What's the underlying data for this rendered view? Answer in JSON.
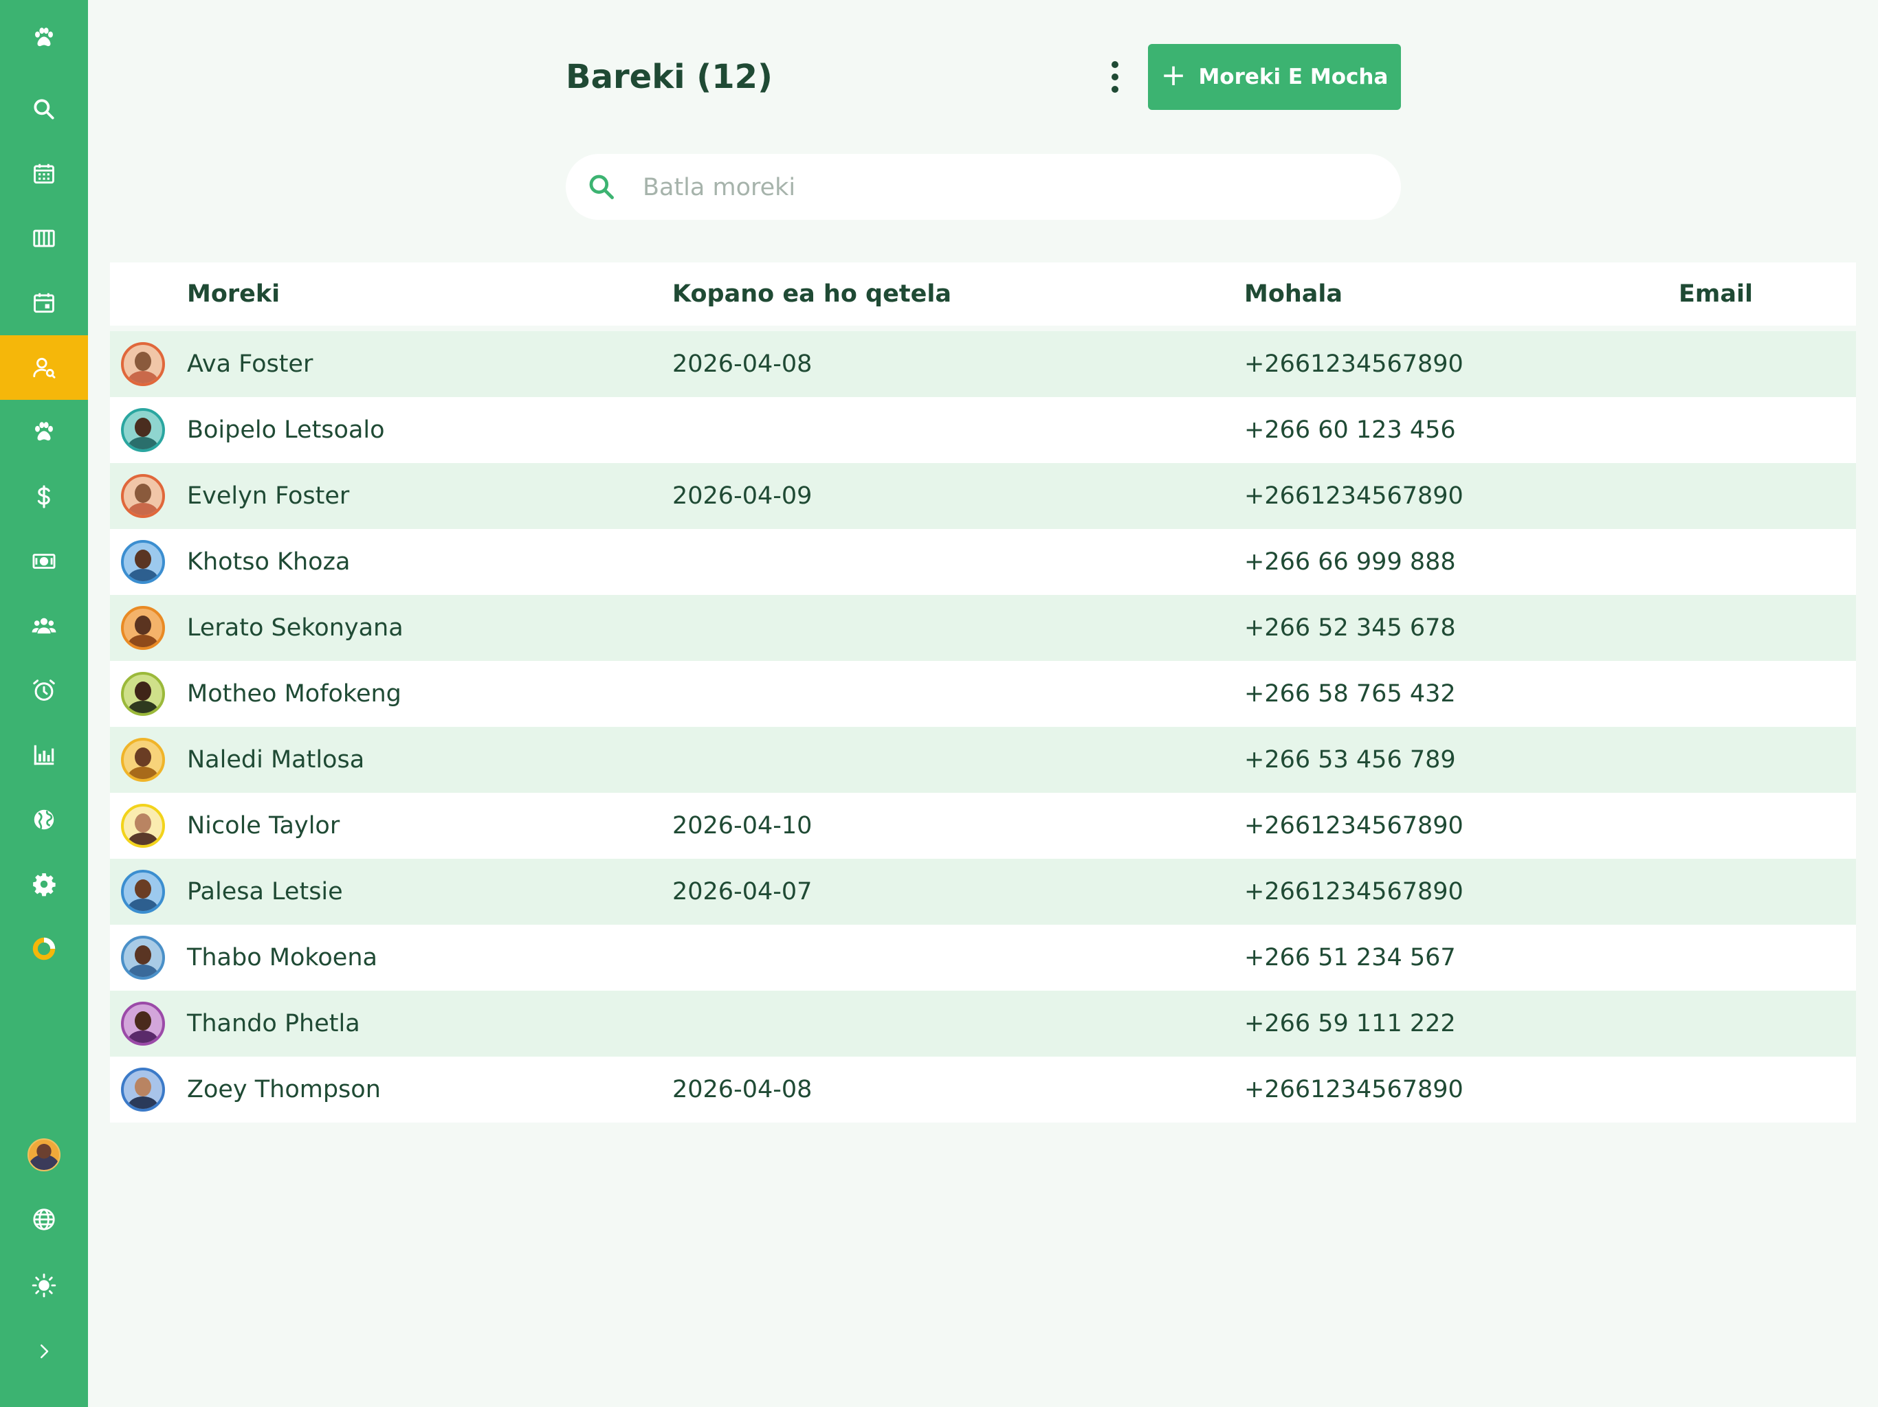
{
  "colors": {
    "brand_green": "#3cb371",
    "active_yellow": "#f5b70a",
    "text_dark": "#1f4a34",
    "row_alt": "#e6f5ea"
  },
  "sidebar": {
    "top_items": [
      {
        "icon": "paw-icon"
      },
      {
        "icon": "search-icon"
      },
      {
        "icon": "calendar-grid-icon"
      },
      {
        "icon": "columns-icon"
      },
      {
        "icon": "calendar-day-icon"
      },
      {
        "icon": "user-search-icon",
        "active": true
      },
      {
        "icon": "paw-icon"
      },
      {
        "icon": "dollar-icon"
      },
      {
        "icon": "cash-icon"
      },
      {
        "icon": "users-icon"
      },
      {
        "icon": "alarm-clock-icon"
      },
      {
        "icon": "bar-chart-icon"
      },
      {
        "icon": "globe-icon"
      },
      {
        "icon": "gear-icon"
      },
      {
        "icon": "donut-chart-icon"
      }
    ],
    "bottom_items": [
      {
        "icon": "user-avatar"
      },
      {
        "icon": "language-globe-icon"
      },
      {
        "icon": "sun-icon"
      },
      {
        "icon": "chevron-right-icon"
      }
    ]
  },
  "header": {
    "title": "Bareki (12)",
    "add_button_label": "Moreki E Mocha"
  },
  "search": {
    "placeholder": "Batla moreki",
    "value": ""
  },
  "table": {
    "columns": [
      "Moreki",
      "Kopano ea ho qetela",
      "Mohala",
      "Email"
    ],
    "rows": [
      {
        "name": "Ava Foster",
        "last_meeting": "2026-04-08",
        "phone": "+2661234567890",
        "email": "",
        "ring": "#e0673b",
        "skin": "#8a5a3c",
        "shirt": "#c9694a",
        "bg": "#f1c6a8"
      },
      {
        "name": "Boipelo Letsoalo",
        "last_meeting": "",
        "phone": "+266 60 123 456",
        "email": "",
        "ring": "#2aa6a0",
        "skin": "#4a2d1f",
        "shirt": "#2a6f6c",
        "bg": "#8fd5cf"
      },
      {
        "name": "Evelyn Foster",
        "last_meeting": "2026-04-09",
        "phone": "+2661234567890",
        "email": "",
        "ring": "#e0673b",
        "skin": "#8a5a3c",
        "shirt": "#c9694a",
        "bg": "#f1c6a8"
      },
      {
        "name": "Khotso Khoza",
        "last_meeting": "",
        "phone": "+266 66 999 888",
        "email": "",
        "ring": "#3b8ed0",
        "skin": "#5a3523",
        "shirt": "#2d5f8f",
        "bg": "#9cc9ee"
      },
      {
        "name": "Lerato Sekonyana",
        "last_meeting": "",
        "phone": "+266 52 345 678",
        "email": "",
        "ring": "#e98a24",
        "skin": "#5b3420",
        "shirt": "#8f4a1a",
        "bg": "#f4b36a"
      },
      {
        "name": "Motheo Mofokeng",
        "last_meeting": "",
        "phone": "+266 58 765 432",
        "email": "",
        "ring": "#9bb93a",
        "skin": "#3f2518",
        "shirt": "#2f3a1f",
        "bg": "#cfe08a"
      },
      {
        "name": "Naledi Matlosa",
        "last_meeting": "",
        "phone": "+266 53 456 789",
        "email": "",
        "ring": "#f0b429",
        "skin": "#6a3d24",
        "shirt": "#a86a1a",
        "bg": "#f7d37a"
      },
      {
        "name": "Nicole Taylor",
        "last_meeting": "2026-04-10",
        "phone": "+2661234567890",
        "email": "",
        "ring": "#f2d31b",
        "skin": "#b98462",
        "shirt": "#5a3a2a",
        "bg": "#faecb0"
      },
      {
        "name": "Palesa Letsie",
        "last_meeting": "2026-04-07",
        "phone": "+2661234567890",
        "email": "",
        "ring": "#3b8ed0",
        "skin": "#6a3d24",
        "shirt": "#2d5f8f",
        "bg": "#9cc9ee"
      },
      {
        "name": "Thabo Mokoena",
        "last_meeting": "",
        "phone": "+266 51 234 567",
        "email": "",
        "ring": "#4a90c8",
        "skin": "#5a3523",
        "shirt": "#3a6a9a",
        "bg": "#a8cbe6"
      },
      {
        "name": "Thando Phetla",
        "last_meeting": "",
        "phone": "+266 59 111 222",
        "email": "",
        "ring": "#9b4aa8",
        "skin": "#4a2a1c",
        "shirt": "#5a2a6a",
        "bg": "#d3a6db"
      },
      {
        "name": "Zoey Thompson",
        "last_meeting": "2026-04-08",
        "phone": "+2661234567890",
        "email": "",
        "ring": "#3b7ac8",
        "skin": "#b98462",
        "shirt": "#2a3a5a",
        "bg": "#a8c4ea"
      }
    ]
  }
}
